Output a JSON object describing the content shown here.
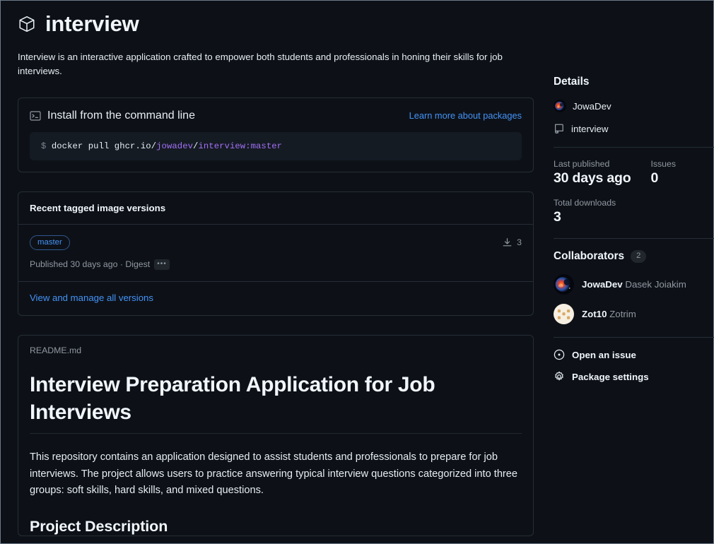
{
  "header": {
    "icon": "package-cube-icon",
    "title": "interview",
    "description": "Interview is an interactive application crafted to empower both students and professionals in honing their skills for job interviews."
  },
  "install": {
    "icon": "terminal-icon",
    "label": "Install from the command line",
    "learn_more": "Learn more about packages",
    "command": {
      "prompt": "$",
      "base": "docker pull ghcr.io",
      "sep1": "/",
      "owner": "jowadev",
      "sep2": "/",
      "image_tag": "interview:master"
    }
  },
  "versions": {
    "heading": "Recent tagged image versions",
    "rows": [
      {
        "tag": "master",
        "downloads": "3",
        "download_icon": "download-icon",
        "published": "Published 30 days ago · Digest",
        "digest_chip": "•••"
      }
    ],
    "footer_link": "View and manage all versions"
  },
  "readme": {
    "filename": "README.md",
    "h1": "Interview Preparation Application for Job Interviews",
    "paragraph": "This repository contains an application designed to assist students and professionals to prepare for job interviews. The project allows users to practice answering typical interview questions categorized into three groups: soft skills, hard skills, and mixed questions.",
    "h2": "Project Description"
  },
  "sidebar": {
    "details": {
      "heading": "Details",
      "owner": "JowaDev",
      "owner_avatar": "jowadev-avatar",
      "repo": "interview",
      "repo_icon": "repo-icon",
      "stats": [
        {
          "label": "Last published",
          "value": "30 days ago"
        },
        {
          "label": "Issues",
          "value": "0"
        }
      ],
      "downloads": {
        "label": "Total downloads",
        "value": "3"
      }
    },
    "collaborators": {
      "heading": "Collaborators",
      "count": "2",
      "people": [
        {
          "username": "JowaDev",
          "fullname": "Dasek Joiakim",
          "avatar": "jowadev-avatar"
        },
        {
          "username": "Zot10",
          "fullname": "Zotrim",
          "avatar": "zot10-avatar"
        }
      ]
    },
    "actions": [
      {
        "label": "Open an issue",
        "icon": "issue-opened-icon"
      },
      {
        "label": "Package settings",
        "icon": "gear-icon"
      }
    ]
  },
  "colors": {
    "background": "#0d1117",
    "link": "#4493f8",
    "accent_purple": "#a371f7",
    "border": "#262d36",
    "muted": "#9198a1"
  }
}
